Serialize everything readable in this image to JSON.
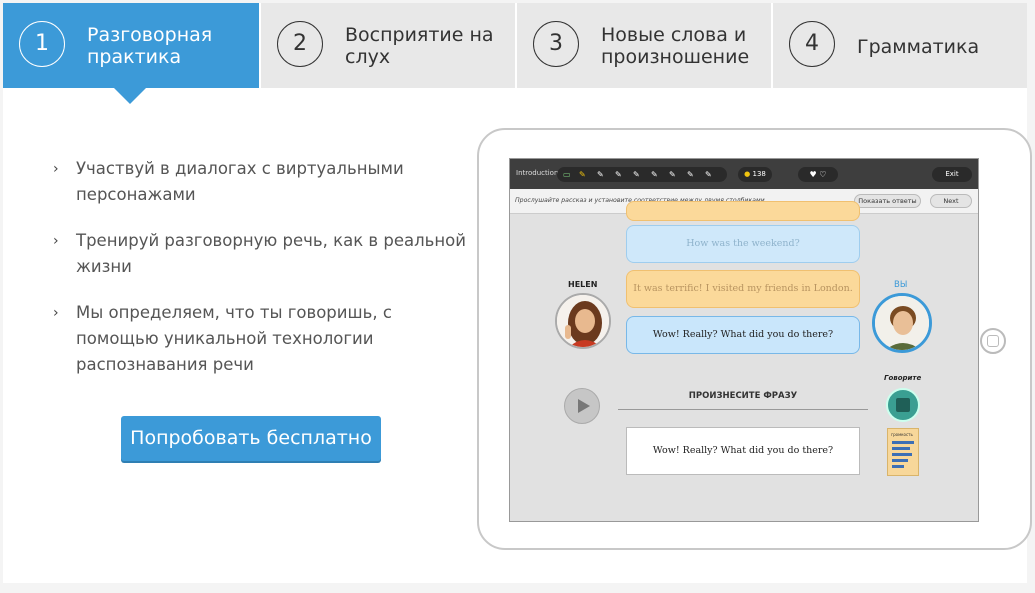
{
  "tabs": [
    {
      "num": "1",
      "label": "Разговорная практика",
      "active": true
    },
    {
      "num": "2",
      "label": "Восприятие на слух",
      "active": false
    },
    {
      "num": "3",
      "label": "Новые слова и произношение",
      "active": false
    },
    {
      "num": "4",
      "label": "Грамматика",
      "active": false
    }
  ],
  "features": [
    "Участвуй в диалогах с виртуальными персонажами",
    "Тренируй разговорную речь, как в реальной жизни",
    "Мы определяем, что ты говоришь, с помощью уникальной технологии распознавания речи"
  ],
  "cta_label": "Попробовать бесплатно",
  "colors": {
    "accent": "#3c9ad8",
    "tab_inactive": "#e8e8e8"
  },
  "app": {
    "title": "Introduction",
    "coins": "138",
    "exit_label": "Exit",
    "instruction": "Прослушайте рассказ и установите соответствие между двумя столбиками.",
    "show_answers_label": "Показать ответы",
    "next_label": "Next",
    "speaker_left": "HELEN",
    "speaker_right": "ВЫ",
    "messages": [
      {
        "from": "me",
        "text": "How was the weekend?",
        "state": "past"
      },
      {
        "from": "helen",
        "text": "It was terrific! I visited my friends in London.",
        "state": "past"
      },
      {
        "from": "me",
        "text": "Wow! Really? What did you do there?",
        "state": "current"
      }
    ],
    "say_phrase_label": "ПРОИЗНЕСИТЕ ФРАЗУ",
    "phrase": "Wow! Really? What did you do there?",
    "speak_label": "Говорите",
    "loudness_label": "громкость",
    "loudness_level": 0.6
  }
}
